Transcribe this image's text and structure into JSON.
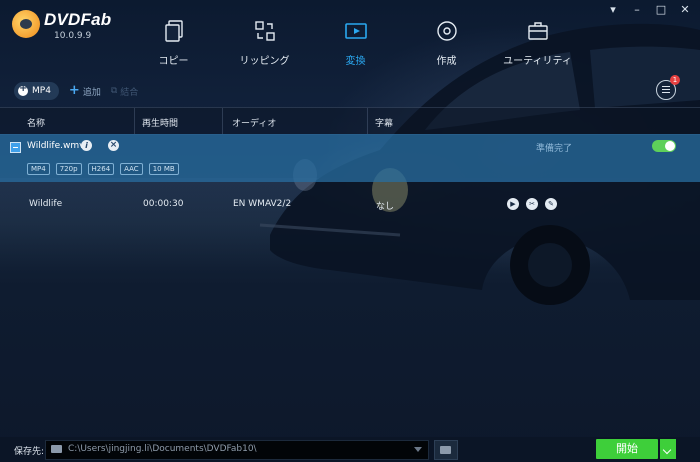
{
  "app": {
    "name": "DVDFab",
    "version": "10.0.9.9"
  },
  "window_controls": [
    "pin-icon",
    "minimize-icon",
    "maximize-icon",
    "close-icon"
  ],
  "nav": [
    {
      "label": "コピー",
      "icon": "copy-icon",
      "active": false
    },
    {
      "label": "リッピング",
      "icon": "ripper-icon",
      "active": false
    },
    {
      "label": "変換",
      "icon": "converter-icon",
      "active": true
    },
    {
      "label": "作成",
      "icon": "creator-icon",
      "active": false
    },
    {
      "label": "ユーティリティ",
      "icon": "utility-icon",
      "active": false
    }
  ],
  "toolbar": {
    "format": "MP4",
    "add": "追加",
    "merge": "結合"
  },
  "task_badge": "1",
  "columns": [
    "名称",
    "再生時間",
    "オーディオ",
    "字幕"
  ],
  "file": {
    "name": "Wildlife.wmv",
    "tags": [
      "MP4",
      "720p",
      "H264",
      "AAC",
      "10 MB"
    ],
    "status": "準備完了"
  },
  "track": {
    "name": "Wildlife",
    "duration": "00:00:30",
    "audio": "EN  WMAV2/2",
    "subtitle": "なし"
  },
  "bottom": {
    "save_label": "保存先:",
    "path": "C:\\Users\\jingjing.li\\Documents\\DVDFab10\\",
    "start": "開始"
  },
  "colors": {
    "accent": "#2aa8f0",
    "start": "#3ecf3a",
    "panel": "#286ea0"
  }
}
